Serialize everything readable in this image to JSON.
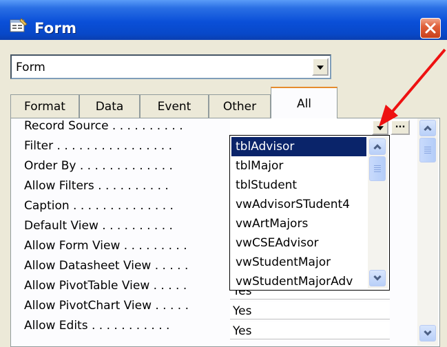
{
  "window": {
    "title": "Form",
    "icon": "form-icon",
    "close_icon": "close-icon"
  },
  "object_selector": {
    "value": "Form"
  },
  "tabs": [
    {
      "label": "Format"
    },
    {
      "label": "Data"
    },
    {
      "label": "Event"
    },
    {
      "label": "Other"
    },
    {
      "label": "All",
      "active": true
    }
  ],
  "properties": [
    {
      "label": "Record Source . . . . . . . . . .",
      "value": ""
    },
    {
      "label": "Filter . . . . . . . . . . . . . . . .",
      "value": ""
    },
    {
      "label": "Order By . . . . . . . . . . . . .",
      "value": ""
    },
    {
      "label": "Allow Filters . . . . . . . . . .",
      "value": ""
    },
    {
      "label": "Caption . . . . . . . . . . . . . .",
      "value": ""
    },
    {
      "label": "Default View . . . . . . . . . .",
      "value": ""
    },
    {
      "label": "Allow Form View . . . . . . . . .",
      "value": ""
    },
    {
      "label": "Allow Datasheet View . . . . .",
      "value": ""
    },
    {
      "label": "Allow PivotTable View . . . . .",
      "value": "Yes"
    },
    {
      "label": "Allow PivotChart View . . . . .",
      "value": "Yes"
    },
    {
      "label": "Allow Edits . . . . . . . . . . .",
      "value": "Yes"
    }
  ],
  "record_source_dropdown": {
    "items": [
      "tblAdvisor",
      "tblMajor",
      "tblStudent",
      "vwAdvisorSTudent4",
      "vwArtMajors",
      "vwCSEAdvisor",
      "vwStudentMajor",
      "vwStudentMajorAdv"
    ],
    "selected_index": 0
  },
  "builder_button": {
    "label": "..."
  },
  "colors": {
    "annotation_arrow": "#ee1111",
    "titlebar": "#0a4fd8",
    "selection": "#0a246a"
  }
}
